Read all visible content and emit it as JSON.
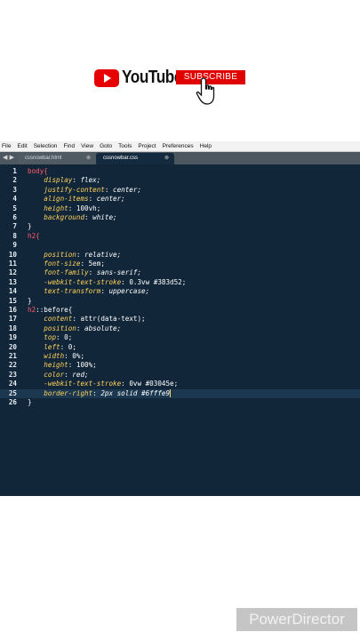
{
  "banner": {
    "brand": "YouTube",
    "subscribe_label": "SUBSCRIBE"
  },
  "menu": [
    "File",
    "Edit",
    "Selection",
    "Find",
    "View",
    "Goto",
    "Tools",
    "Project",
    "Preferences",
    "Help"
  ],
  "tabs": [
    {
      "label": "cssnowbar.html",
      "active": false
    },
    {
      "label": "cssnowbar.css",
      "active": true
    }
  ],
  "colors": {
    "editor_bg": "#12263a",
    "selector": "#ff5a6a",
    "property": "#ffd25a",
    "youtube_red": "#e60000"
  },
  "code": {
    "l1": "body{",
    "l2p": "display",
    "l2v": " flex;",
    "l3p": "justify-content",
    "l3v": " center;",
    "l4p": "align-items",
    "l4v": " center;",
    "l5p": "height",
    "l5v": " 100vh;",
    "l6p": "background",
    "l6v": " white;",
    "l7": "}",
    "l8": "h2{",
    "l10p": "position",
    "l10v": " relative;",
    "l11p": "font-size",
    "l11v": " 5em;",
    "l12p": "font-family",
    "l12v": " sans-serif;",
    "l13p": "-webkit-text-stroke",
    "l13v": " 0.3vw #383d52;",
    "l14p": "text-transform",
    "l14v": " uppercase;",
    "l15": "}",
    "l16s": "h2",
    "l16pe": "::before{",
    "l17p": "content",
    "l17v": " attr(data-text);",
    "l18p": "position",
    "l18v": " absolute;",
    "l19p": "top",
    "l19v": " 0;",
    "l20p": "left",
    "l20v": " 0;",
    "l21p": "width",
    "l21v": " 0%;",
    "l22p": "height",
    "l22v": " 100%;",
    "l23p": "color",
    "l23v": " red;",
    "l24p": "-webkit-text-stroke",
    "l24v": " 0vw #03045e;",
    "l25p": "border-right",
    "l25v": " 2px solid #6fffe9",
    "l26": "}"
  },
  "watermark": "PowerDirector"
}
